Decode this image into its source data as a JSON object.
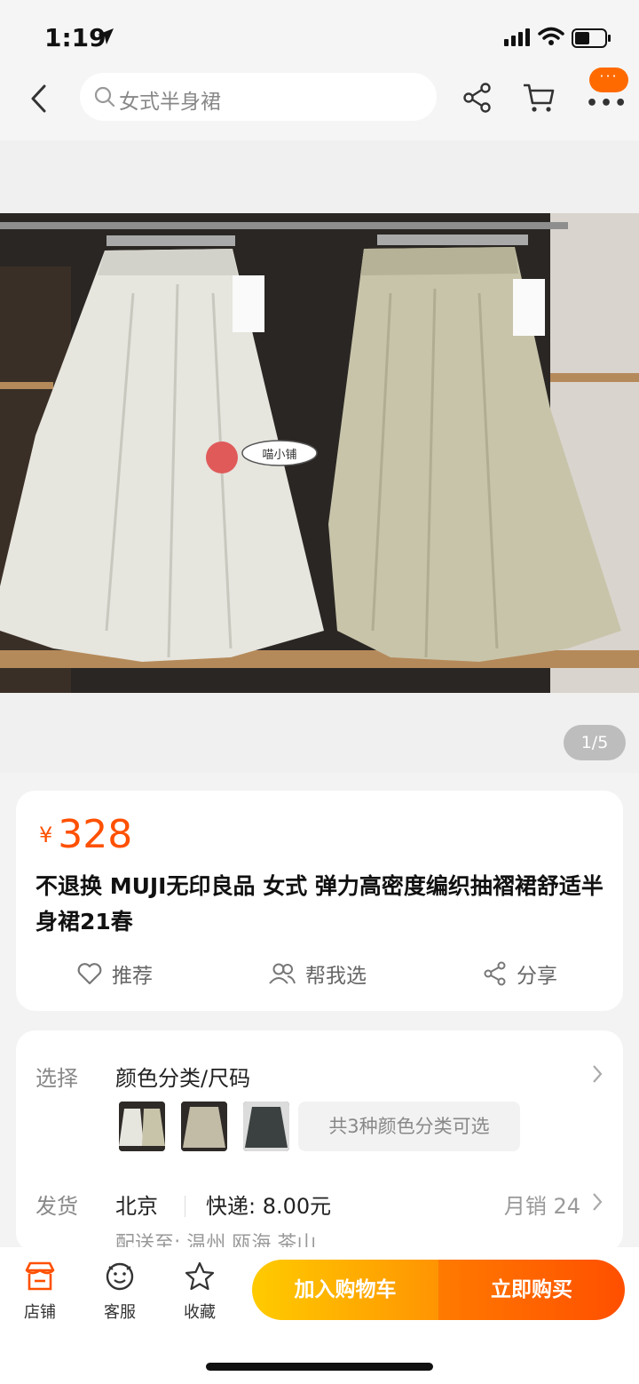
{
  "status_bar": {
    "time": "1:19"
  },
  "search": {
    "query": "女式半身裙"
  },
  "nav": {
    "more_badge": "···"
  },
  "gallery": {
    "counter": "1/5",
    "watermark": "喵小铺"
  },
  "product": {
    "price_symbol": "¥",
    "price": "328",
    "title": "不退换 MUJI无印良品 女式 弹力高密度编织抽褶裙舒适半身裙21春"
  },
  "actions": {
    "recommend": "推荐",
    "help_choose": "帮我选",
    "share": "分享"
  },
  "spec": {
    "select_label": "选择",
    "select_value": "颜色分类/尺码",
    "variant_summary": "共3种颜色分类可选",
    "ship_label": "发货",
    "origin": "北京",
    "express": "快递: 8.00元",
    "monthly_sales": "月销 24",
    "deliver_to": "配送至: 温州 瓯海 茶山"
  },
  "bottom_bar": {
    "store": "店铺",
    "service": "客服",
    "favorite": "收藏",
    "add_to_cart": "加入购物车",
    "buy_now": "立即购买"
  },
  "colors": {
    "accent": "#ff5000",
    "cart_gradient": [
      "#ffcb00",
      "#ff9402"
    ],
    "buy_gradient": [
      "#ff7a00",
      "#ff4f00"
    ]
  }
}
